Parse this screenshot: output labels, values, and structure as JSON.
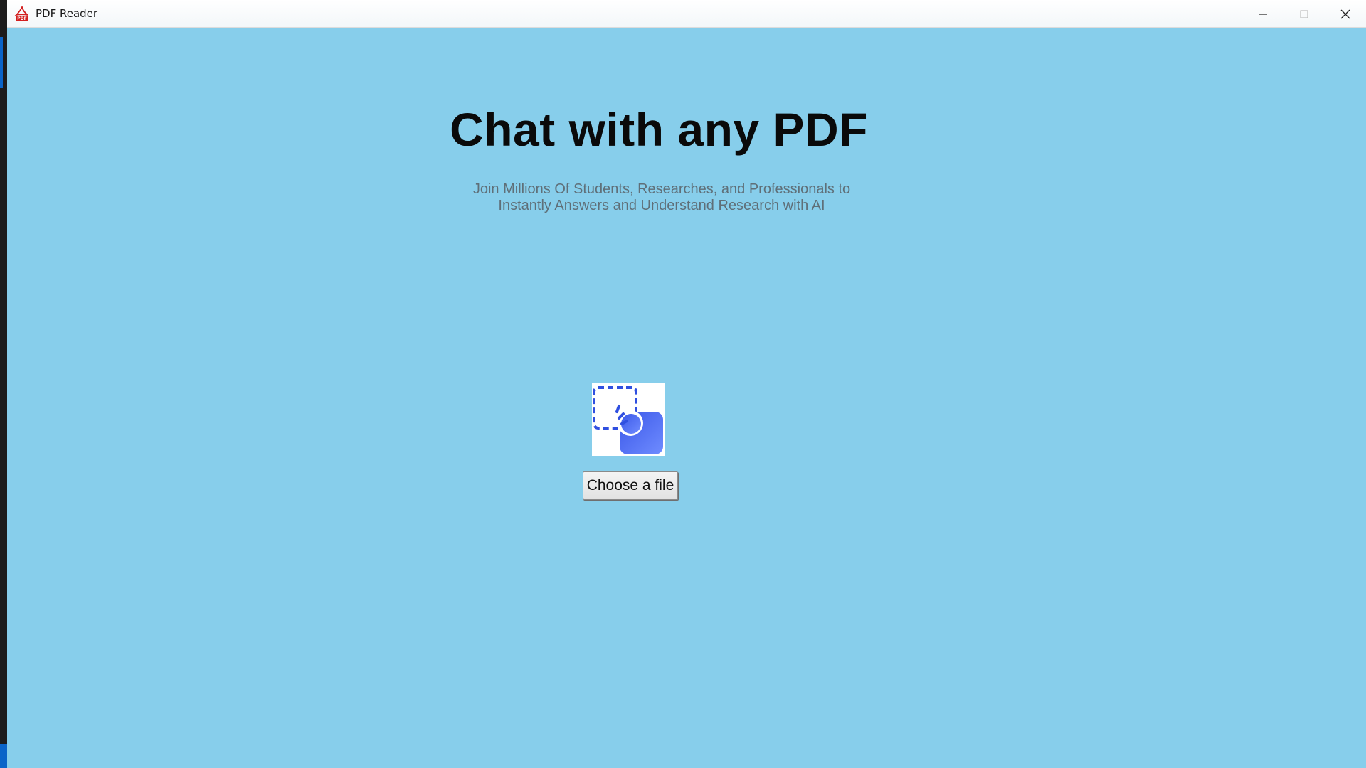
{
  "window": {
    "title": "PDF Reader",
    "app_icon": "pdf-icon",
    "controls": [
      "minimize-icon",
      "maximize-icon",
      "close-icon"
    ]
  },
  "main": {
    "headline": "Chat with any PDF",
    "subtitle_line1": "Join Millions Of Students, Researches, and Professionals to",
    "subtitle_line2": "Instantly Answers and Understand Research with AI",
    "upload_icon": "drag-select-icon",
    "choose_button_label": "Choose a file"
  },
  "colors": {
    "background": "#87ceeb",
    "headline": "#0a0a0a",
    "subtitle": "#5f6f78",
    "icon_accent": "#4f6cf7"
  }
}
